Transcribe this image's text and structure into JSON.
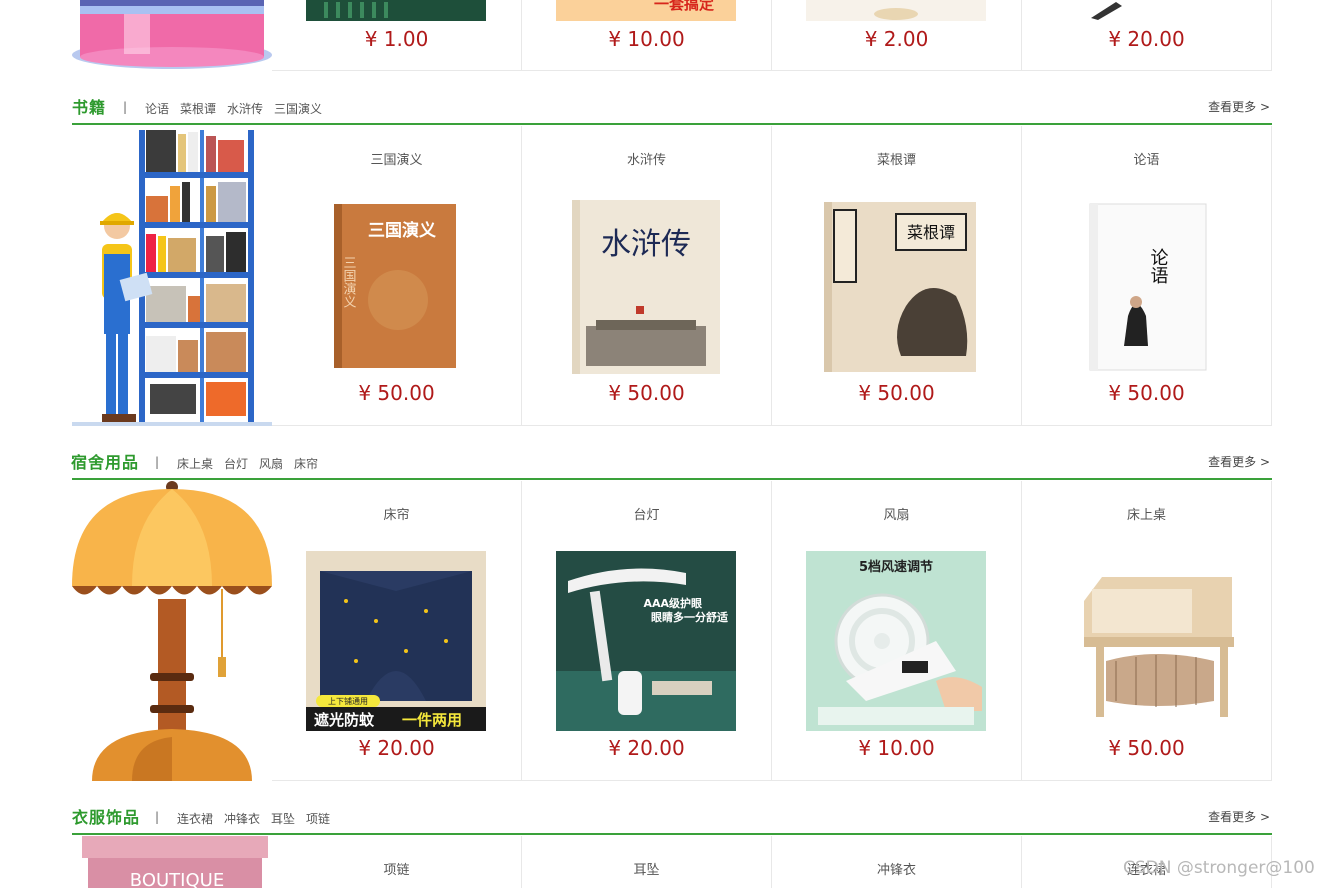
{
  "top_row": {
    "prices": [
      "¥ 1.00",
      "¥ 10.00",
      "¥ 2.00",
      "¥ 20.00"
    ],
    "banner_text": "一套搞定"
  },
  "sections": [
    {
      "title": "书籍",
      "sep": "|",
      "tags": [
        "论语",
        "菜根谭",
        "水浒传",
        "三国演义"
      ],
      "more": "查看更多 >",
      "products": [
        {
          "name": "三国演义",
          "price": "¥ 50.00",
          "cover": "三国演义"
        },
        {
          "name": "水浒传",
          "price": "¥ 50.00",
          "cover": "水浒传"
        },
        {
          "name": "菜根谭",
          "price": "¥ 50.00",
          "cover": "菜根谭"
        },
        {
          "name": "论语",
          "price": "¥ 50.00",
          "cover": "论语"
        }
      ]
    },
    {
      "title": "宿舍用品",
      "sep": "|",
      "tags": [
        "床上桌",
        "台灯",
        "风扇",
        "床帘"
      ],
      "more": "查看更多 >",
      "products": [
        {
          "name": "床帘",
          "price": "¥ 20.00",
          "badge": "上下铺通用",
          "caption_a": "遮光防蚊",
          "caption_b": "一件两用"
        },
        {
          "name": "台灯",
          "price": "¥ 20.00",
          "line1": "AAA级护眼",
          "line2": "眼睛多一分舒适"
        },
        {
          "name": "风扇",
          "price": "¥ 10.00",
          "line1": "5档风速调节"
        },
        {
          "name": "床上桌",
          "price": "¥ 50.00"
        }
      ]
    },
    {
      "title": "衣服饰品",
      "sep": "|",
      "tags": [
        "连衣裙",
        "冲锋衣",
        "耳坠",
        "项链"
      ],
      "more": "查看更多 >",
      "hero_text": "BOUTIQUE",
      "products": [
        {
          "name": "项链"
        },
        {
          "name": "耳坠"
        },
        {
          "name": "冲锋衣"
        },
        {
          "name": "连衣裙"
        }
      ]
    }
  ],
  "watermark": "CSDN @stronger@100",
  "colors": {
    "accent_green": "#3aa13a",
    "price_red": "#b01a1a"
  }
}
